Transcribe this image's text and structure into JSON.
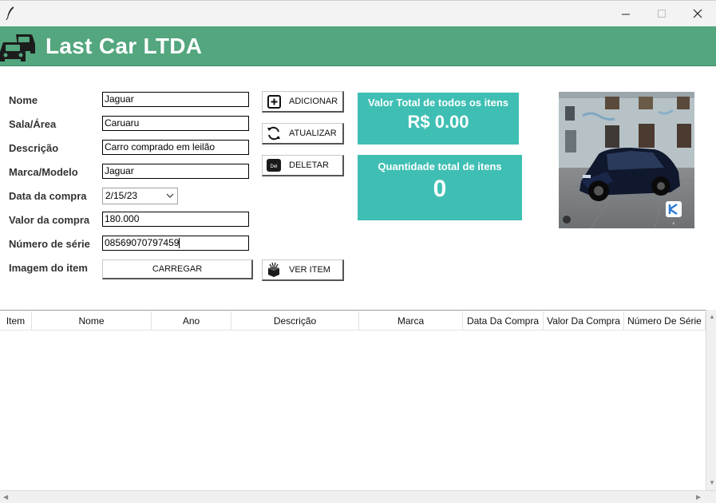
{
  "window": {
    "controls": {
      "minimize": "minimize",
      "maximize": "maximize",
      "close": "close"
    }
  },
  "header": {
    "title": "Last Car LTDA"
  },
  "form": {
    "labels": {
      "nome": "Nome",
      "sala": "Sala/Área",
      "descricao": "Descrição",
      "marca": "Marca/Modelo",
      "data": "Data da compra",
      "valor": "Valor da compra",
      "serie": "Número de série",
      "imagem": "Imagem do item"
    },
    "values": {
      "nome": "Jaguar",
      "sala": "Caruaru",
      "descricao": "Carro comprado em leilão",
      "marca": "Jaguar",
      "data": "2/15/23",
      "valor": "180.000",
      "serie": "08569070797459"
    },
    "upload_button": "CARREGAR"
  },
  "actions": {
    "add": "ADICIONAR",
    "update": "ATUALIZAR",
    "delete": "DELETAR",
    "delete_icon_text": "Del",
    "view": "VER ITEM"
  },
  "summary": {
    "total_title": "Valor Total de todos os itens",
    "total_value": "R$ 0.00",
    "qty_title": "Quantidade total de itens",
    "qty_value": "0"
  },
  "table": {
    "columns": [
      "Item",
      "Nome",
      "Ano",
      "Descrição",
      "Marca",
      "Data Da Compra",
      "Valor Da Compra",
      "Número De Série"
    ],
    "rows": []
  },
  "photo": {
    "watermark": "K"
  },
  "colors": {
    "header": "#53a67e",
    "card": "#3fbfb4"
  }
}
